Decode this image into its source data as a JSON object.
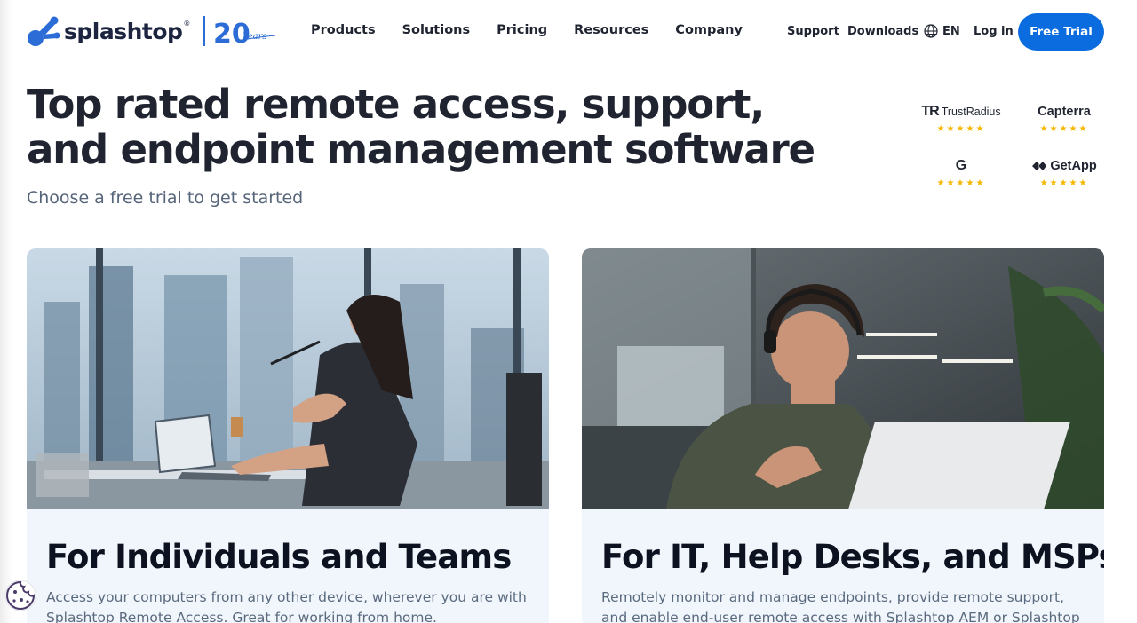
{
  "brand": {
    "name": "splashtop",
    "tm": "®",
    "anniversary_number": "20",
    "anniversary_word": "Years"
  },
  "nav": [
    {
      "label": "Products"
    },
    {
      "label": "Solutions"
    },
    {
      "label": "Pricing"
    },
    {
      "label": "Resources"
    },
    {
      "label": "Company"
    }
  ],
  "utility": {
    "support": "Support",
    "downloads": "Downloads",
    "language": "EN",
    "login": "Log in",
    "cta": "Free Trial"
  },
  "hero": {
    "title_line1": "Top rated remote access, support,",
    "title_line2": "and endpoint management software",
    "subtitle": "Choose a free trial to get started"
  },
  "reviews": [
    {
      "name": "TrustRadius",
      "mark": "TR",
      "stars": "★★★★★",
      "icon": "trustradius-logo"
    },
    {
      "name": "Capterra",
      "mark": "",
      "stars": "★★★★★",
      "icon": "capterra-logo"
    },
    {
      "name": "",
      "mark": "G",
      "stars": "★★★★★",
      "icon": "g2-logo"
    },
    {
      "name": "GetApp",
      "mark": "",
      "stars": "★★★★★",
      "icon": "getapp-logo"
    }
  ],
  "cards": [
    {
      "title": "For Individuals and Teams",
      "description": "Access your computers from any other device, wherever you are with Splashtop Remote Access. Great for working from home.",
      "image": "woman-working-at-laptop-office-photo"
    },
    {
      "title": "For IT, Help Desks, and MSPs",
      "description": "Remotely monitor and manage endpoints, provide remote support, and enable end-user remote access with Splashtop AEM or Splashtop",
      "image": "man-with-headset-at-laptop-photo"
    }
  ],
  "colors": {
    "accent": "#0a6cde",
    "heading": "#1f2430",
    "subtle": "#56657a",
    "card_bg": "#f1f6fc",
    "star": "#f5b700"
  },
  "icons": {
    "globe": "globe-icon",
    "cookie": "cookie-settings-icon"
  }
}
